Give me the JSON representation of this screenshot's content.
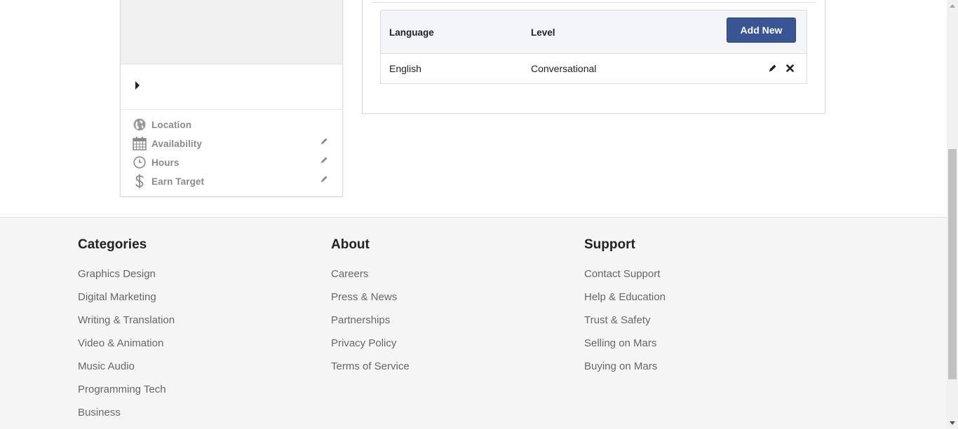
{
  "profile": {
    "details": [
      {
        "label": "Location",
        "icon": "globe-icon",
        "editable": false
      },
      {
        "label": "Availability",
        "icon": "calendar-icon",
        "editable": true
      },
      {
        "label": "Hours",
        "icon": "clock-icon",
        "editable": true
      },
      {
        "label": "Earn Target",
        "icon": "dollar-icon",
        "editable": true
      }
    ]
  },
  "languages": {
    "headers": {
      "language": "Language",
      "level": "Level"
    },
    "add_button": "Add New",
    "rows": [
      {
        "language": "English",
        "level": "Conversational"
      }
    ]
  },
  "footer": {
    "categories": {
      "title": "Categories",
      "links": [
        "Graphics Design",
        "Digital Marketing",
        "Writing & Translation",
        "Video & Animation",
        "Music Audio",
        "Programming Tech",
        "Business"
      ]
    },
    "about": {
      "title": "About",
      "links": [
        "Careers",
        "Press & News",
        "Partnerships",
        "Privacy Policy",
        "Terms of Service"
      ]
    },
    "support": {
      "title": "Support",
      "links": [
        "Contact Support",
        "Help & Education",
        "Trust & Safety",
        "Selling on Mars",
        "Buying on Mars"
      ]
    }
  },
  "colors": {
    "primary_button": "#3a5594",
    "footer_bg": "#f5f5f5",
    "table_header_bg": "#f3f5f8"
  }
}
